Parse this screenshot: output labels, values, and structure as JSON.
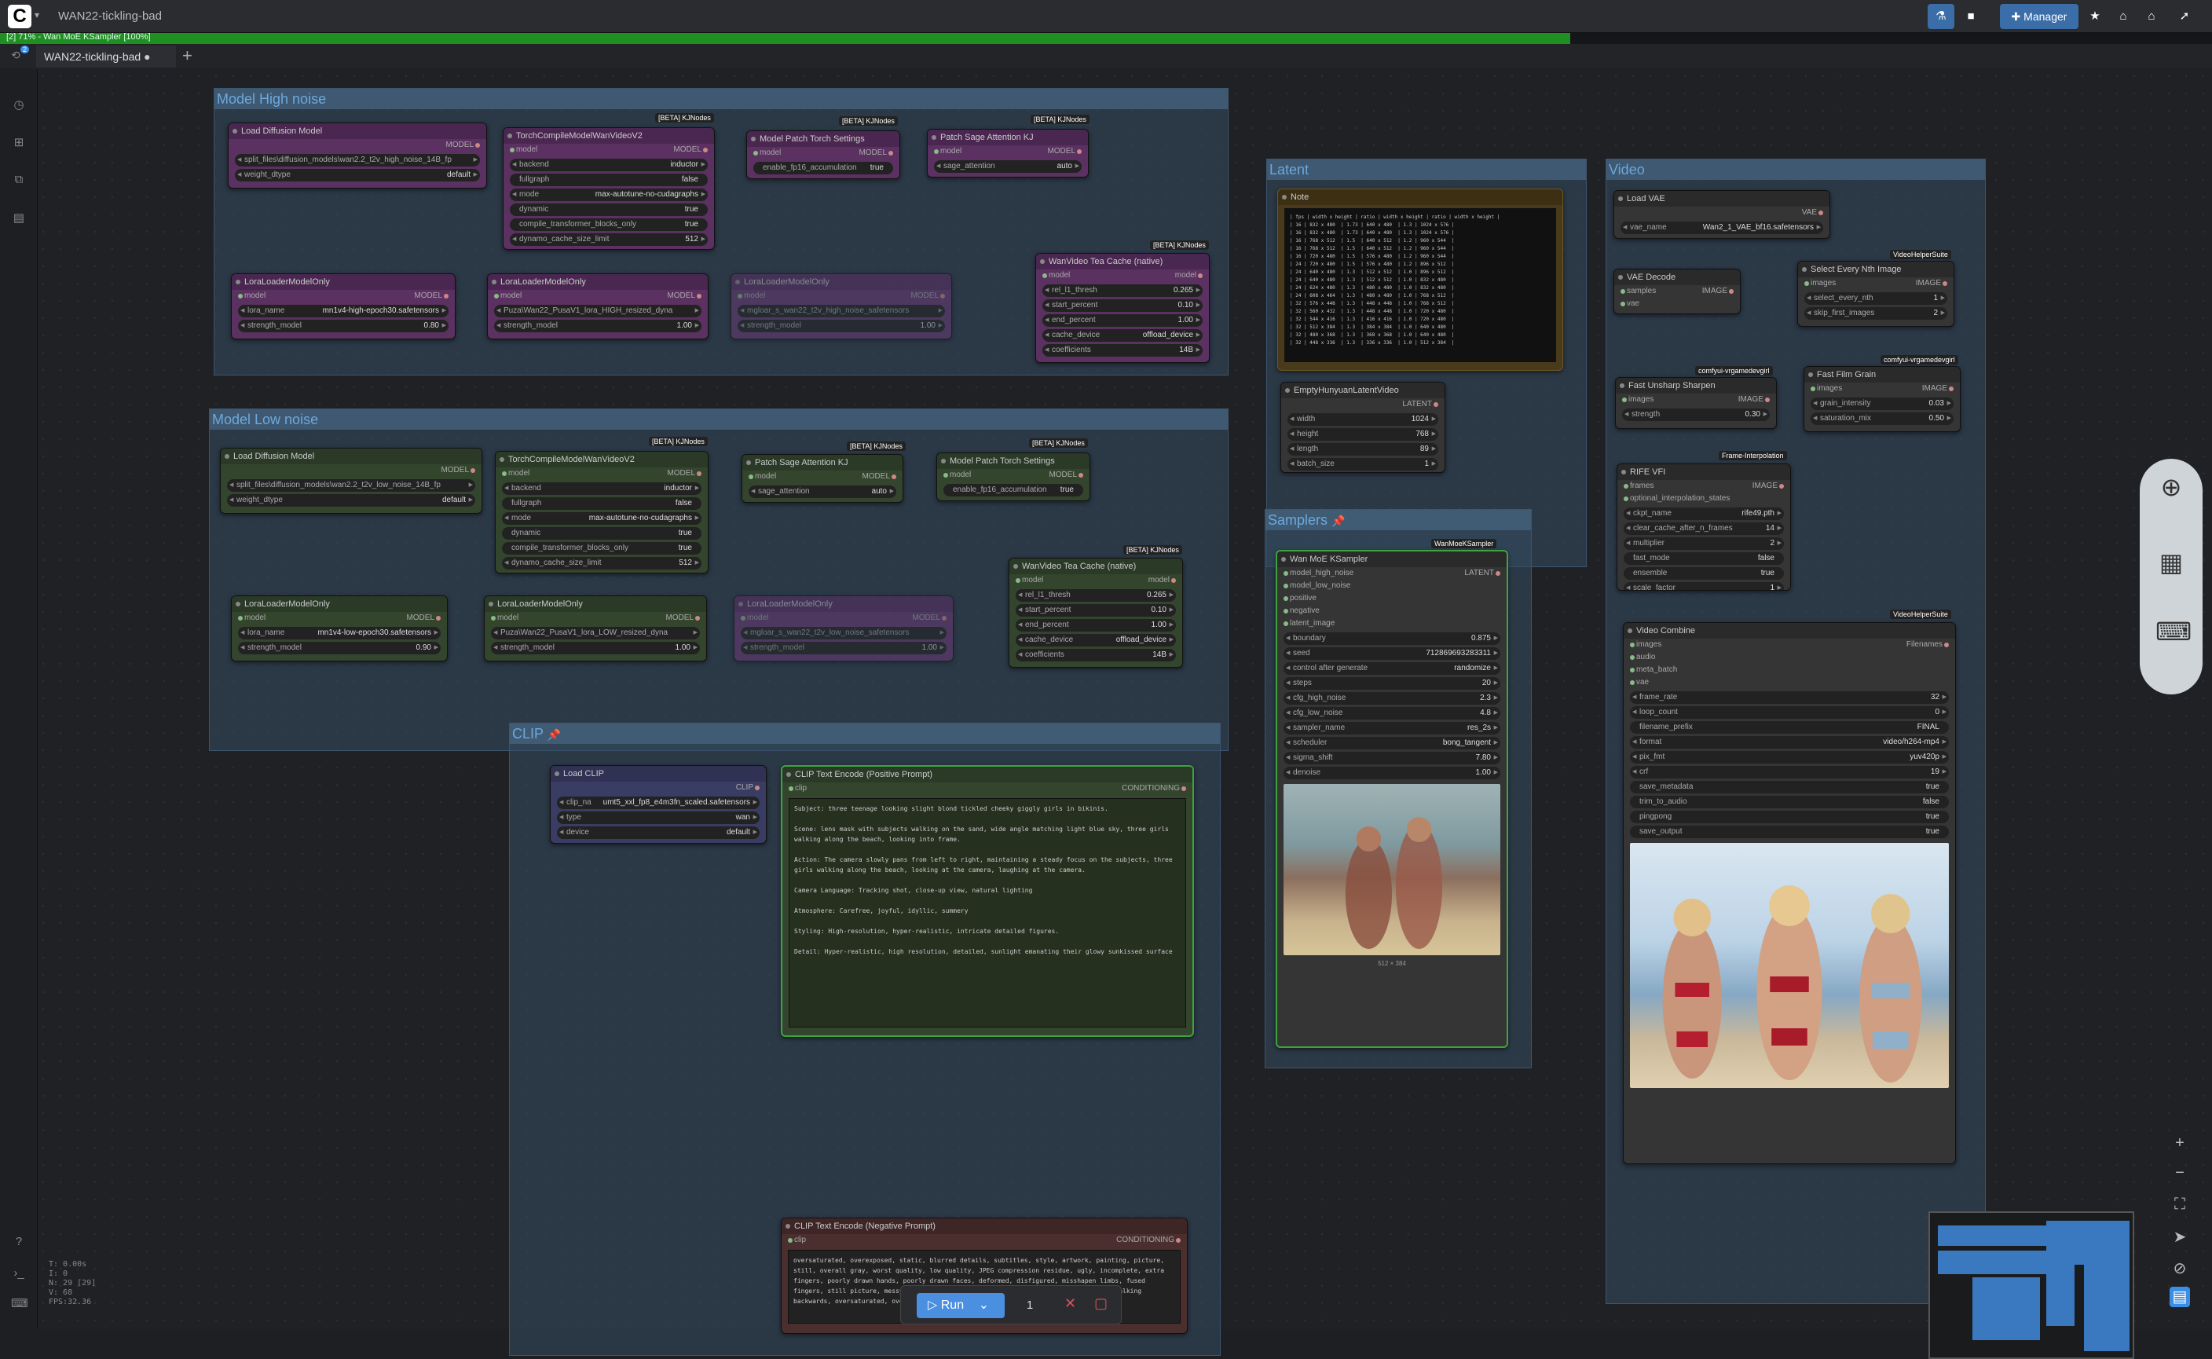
{
  "app": {
    "title": "WAN22-tickling-bad",
    "tab": "WAN22-tickling-bad",
    "progress_text": "[2] 71% - Wan MoE KSampler [100%]",
    "progress": 0.71,
    "tab_badge": "2"
  },
  "toolbar": {
    "manager_label": "Manager"
  },
  "groups": {
    "high": "Model High noise",
    "low": "Model Low noise",
    "clip": "CLIP",
    "latent": "Latent",
    "samplers": "Samplers",
    "video": "Video"
  },
  "high": {
    "load": {
      "title": "Load Diffusion Model",
      "out": "MODEL",
      "unet": "split_files\\diffusion_models\\wan2.2_t2v_high_noise_14B_fp",
      "dtype_k": "weight_dtype",
      "dtype": "default"
    },
    "compile": {
      "title": "TorchCompileModelWanVideoV2",
      "badge": "[BETA] KJNodes",
      "in": "model",
      "out": "MODEL",
      "backend": "inductor",
      "fullgraph": "false",
      "mode": "max-autotune-no-cudagraphs",
      "dynamic": "true",
      "blocks": "true",
      "cache": "512"
    },
    "patch": {
      "title": "Model Patch Torch Settings",
      "badge": "[BETA] KJNodes",
      "in": "model",
      "out": "MODEL",
      "acc": "true"
    },
    "sage": {
      "title": "Patch Sage Attention KJ",
      "badge": "[BETA] KJNodes",
      "in": "model",
      "out": "MODEL",
      "sage": "auto"
    },
    "lora1": {
      "title": "LoraLoaderModelOnly",
      "lora": "mn1v4-high-epoch30.safetensors",
      "strength": "0.80"
    },
    "lora2": {
      "title": "LoraLoaderModelOnly",
      "lora": "Puza\\Wan22_PusaV1_lora_HIGH_resized_dyna",
      "strength": "1.00"
    },
    "lora3": {
      "title": "LoraLoaderModelOnly",
      "lora": "mgloar_s_wan22_t2v_high_noise_safetensors",
      "strength": "1.00"
    },
    "tea": {
      "title": "WanVideo Tea Cache (native)",
      "badge": "[BETA] KJNodes",
      "thresh": "0.265",
      "start": "0.10",
      "end": "1.00",
      "device": "offload_device",
      "coef": "14B"
    }
  },
  "low": {
    "load": {
      "title": "Load Diffusion Model",
      "out": "MODEL",
      "unet": "split_files\\diffusion_models\\wan2.2_t2v_low_noise_14B_fp",
      "dtype": "default"
    },
    "compile": {
      "title": "TorchCompileModelWanVideoV2",
      "badge": "[BETA] KJNodes",
      "backend": "inductor",
      "fullgraph": "false",
      "mode": "max-autotune-no-cudagraphs",
      "dynamic": "true",
      "blocks": "true",
      "cache": "512"
    },
    "sage": {
      "title": "Patch Sage Attention KJ",
      "badge": "[BETA] KJNodes",
      "sage": "auto"
    },
    "patch": {
      "title": "Model Patch Torch Settings",
      "badge": "[BETA] KJNodes",
      "acc": "true"
    },
    "lora1": {
      "title": "LoraLoaderModelOnly",
      "lora": "mn1v4-low-epoch30.safetensors",
      "strength": "0.90"
    },
    "lora2": {
      "title": "LoraLoaderModelOnly",
      "lora": "Puza\\Wan22_PusaV1_lora_LOW_resized_dyna",
      "strength": "1.00"
    },
    "lora3": {
      "title": "LoraLoaderModelOnly",
      "lora": "mgloar_s_wan22_t2v_low_noise_safetensors",
      "strength": "1.00"
    },
    "tea": {
      "title": "WanVideo Tea Cache (native)",
      "badge": "[BETA] KJNodes",
      "thresh": "0.265",
      "start": "0.10",
      "end": "1.00",
      "device": "offload_device",
      "coef": "14B"
    }
  },
  "clip": {
    "load": {
      "title": "Load CLIP",
      "out": "CLIP",
      "name": "umt5_xxl_fp8_e4m3fn_scaled.safetensors",
      "type": "wan",
      "device": "default"
    },
    "pos": {
      "title": "CLIP Text Encode (Positive Prompt)",
      "in": "clip",
      "out": "CONDITIONING",
      "text": "Subject: three teenage looking slight blond tickled cheeky giggly girls in bikinis.\n\nScene: lens mask with subjects walking on the sand, wide angle matching light blue sky, three girls walking along the beach, looking into frame.\n\nAction: The camera slowly pans from left to right, maintaining a steady focus on the subjects, three girls walking along the beach, looking at the camera, laughing at the camera.\n\nCamera Language: Tracking shot, close-up view, natural lighting\n\nAtmosphere: Carefree, joyful, idyllic, summery\n\nStyling: High-resolution, hyper-realistic, intricate detailed figures.\n\nDetail: Hyper-realistic, high resolution, detailed, sunlight emanating their glowy sunkissed surface"
    },
    "neg": {
      "title": "CLIP Text Encode (Negative Prompt)",
      "in": "clip",
      "out": "CONDITIONING",
      "text": "oversaturated, overexposed, static, blurred details, subtitles, style, artwork, painting, picture, still, overall gray, worst quality, low quality, JPEG compression residue, ugly, incomplete, extra fingers, poorly drawn hands, poorly drawn faces, deformed, disfigured, misshapen limbs, fused fingers, still picture, messy background, three legs, many people in the background, walking backwards, oversaturated, overexposed, static, blurred details, subtitles"
    }
  },
  "latent": {
    "note": {
      "title": "Note",
      "text": "| fps | width x height | ratio | width x height | ratio | width x height |\n| 16 | 832 x 480  | 1.73 | 640 x 480  | 1.3 | 1024 x 576 |\n| 16 | 832 x 480  | 1.73 | 640 x 480  | 1.3 | 1024 x 576 |\n| 16 | 768 x 512  | 1.5  | 640 x 512  | 1.2 | 960 x 544  |\n| 16 | 768 x 512  | 1.5  | 640 x 512  | 1.2 | 960 x 544  |\n| 16 | 720 x 480  | 1.5  | 576 x 480  | 1.2 | 960 x 544  |\n| 24 | 720 x 480  | 1.5  | 576 x 480  | 1.2 | 896 x 512  |\n| 24 | 640 x 480  | 1.3  | 512 x 512  | 1.0 | 896 x 512  |\n| 24 | 640 x 480  | 1.3  | 512 x 512  | 1.0 | 832 x 480  |\n| 24 | 624 x 480  | 1.3  | 480 x 480  | 1.0 | 832 x 480  |\n| 24 | 608 x 464  | 1.3  | 480 x 480  | 1.0 | 768 x 512  |\n| 32 | 576 x 448  | 1.3  | 448 x 448  | 1.0 | 768 x 512  |\n| 32 | 560 x 432  | 1.3  | 448 x 448  | 1.0 | 720 x 480  |\n| 32 | 544 x 416  | 1.3  | 416 x 416  | 1.0 | 720 x 480  |\n| 32 | 512 x 384  | 1.3  | 384 x 384  | 1.0 | 640 x 480  |\n| 32 | 480 x 368  | 1.3  | 368 x 368  | 1.0 | 640 x 480  |\n| 32 | 448 x 336  | 1.3  | 336 x 336  | 1.0 | 512 x 384  |"
    },
    "empty": {
      "title": "EmptyHunyuanLatentVideo",
      "out": "LATENT",
      "width": "1024",
      "height": "768",
      "length": "89",
      "batch": "1"
    }
  },
  "sampler": {
    "title": "Wan MoE KSampler",
    "badge": "WanMoeKSampler",
    "out": "LATENT",
    "inputs": [
      "model_high_noise",
      "model_low_noise",
      "positive",
      "negative",
      "latent_image"
    ],
    "boundary": "0.875",
    "seed": "712869693283311",
    "cag": "randomize",
    "steps": "20",
    "cfg_hi": "2.3",
    "cfg_lo": "4.8",
    "sampler": "res_2s",
    "scheduler": "bong_tangent",
    "shift": "7.80",
    "denoise": "1.00",
    "size": "512 × 384"
  },
  "video": {
    "vae": {
      "title": "Load VAE",
      "out": "VAE",
      "name": "Wan2_1_VAE_bf16.safetensors"
    },
    "decode": {
      "title": "VAE Decode",
      "in1": "samples",
      "in2": "vae",
      "out": "IMAGE"
    },
    "every": {
      "title": "Select Every Nth Image",
      "badge": "VideoHelperSuite",
      "in": "images",
      "out": "IMAGE",
      "nth": "1",
      "skip": "2"
    },
    "sharp": {
      "title": "Fast Unsharp Sharpen",
      "badge": "comfyui-vrgamedevgirl",
      "in": "images",
      "out": "IMAGE",
      "strength": "0.30"
    },
    "grain": {
      "title": "Fast Film Grain",
      "badge": "comfyui-vrgamedevgirl",
      "in": "images",
      "out": "IMAGE",
      "intensity": "0.03",
      "sat": "0.50"
    },
    "rife": {
      "title": "RIFE VFI",
      "badge": "Frame-Interpolation",
      "in1": "frames",
      "in2": "optional_interpolation_states",
      "out": "IMAGE",
      "ckpt": "rife49.pth",
      "clear": "14",
      "mult": "2",
      "fast": "false",
      "ensemble": "true",
      "scale": "1"
    },
    "combine": {
      "title": "Video Combine",
      "badge": "VideoHelperSuite",
      "inputs": [
        "images",
        "audio",
        "meta_batch",
        "vae"
      ],
      "out": "Filenames",
      "fps": "32",
      "loop": "0",
      "prefix": "FINAL",
      "format": "video/h264-mp4",
      "pix": "yuv420p",
      "crf": "19",
      "meta": "true",
      "trim": "false",
      "ping": "true",
      "save": "true"
    }
  },
  "run": {
    "label": "Run",
    "count": "1"
  },
  "stats": {
    "t": "T: 0.00s",
    "i": "I: 0",
    "n": "N: 29 [29]",
    "v": "V: 68",
    "fps": "FPS:32.36"
  }
}
